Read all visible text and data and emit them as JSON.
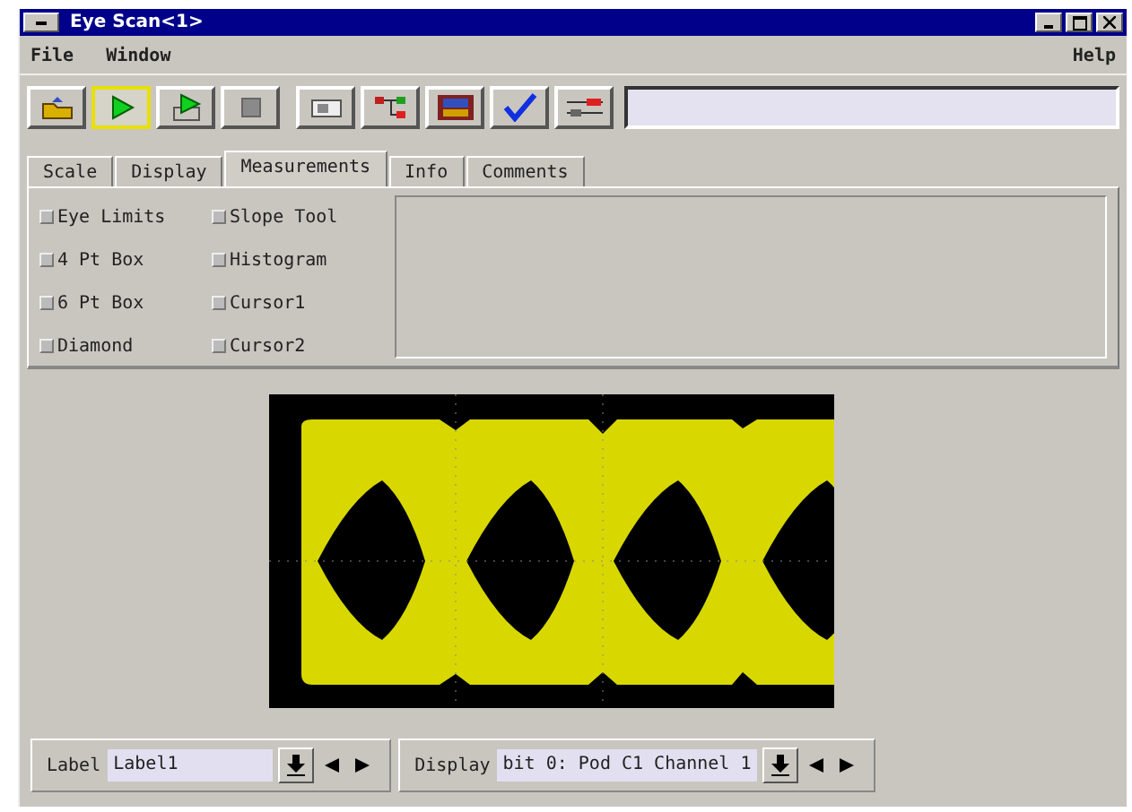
{
  "window": {
    "title": "Eye Scan<1>"
  },
  "menu": [
    "File",
    "Window",
    "Help"
  ],
  "toolbar": [
    {
      "selected": false
    },
    {
      "selected": true
    },
    {
      "selected": false
    },
    {
      "selected": false
    },
    {
      "selected": false
    },
    {
      "selected": false
    },
    {
      "selected": false
    },
    {
      "selected": false
    },
    {
      "selected": false
    }
  ],
  "tabs": [
    {
      "label": "Scale",
      "selected": false
    },
    {
      "label": "Display",
      "selected": false
    },
    {
      "label": "Measurements",
      "selected": true
    },
    {
      "label": "Info",
      "selected": false
    },
    {
      "label": "Comments",
      "selected": false
    }
  ],
  "measurements": [
    {
      "label": "Eye Limits",
      "checked": false
    },
    {
      "label": "Slope Tool",
      "checked": false
    },
    {
      "label": "4 Pt Box",
      "checked": false
    },
    {
      "label": "Histogram",
      "checked": false
    },
    {
      "label": "6 Pt Box",
      "checked": false
    },
    {
      "label": "Cursor1",
      "checked": false
    },
    {
      "label": "Diamond",
      "checked": false
    },
    {
      "label": "Cursor2",
      "checked": false
    }
  ],
  "bottom": {
    "label_caption": "Label",
    "label_value": "Label1",
    "display_caption": "Display",
    "display_value": "bit 0: Pod C1 Channel 1"
  }
}
